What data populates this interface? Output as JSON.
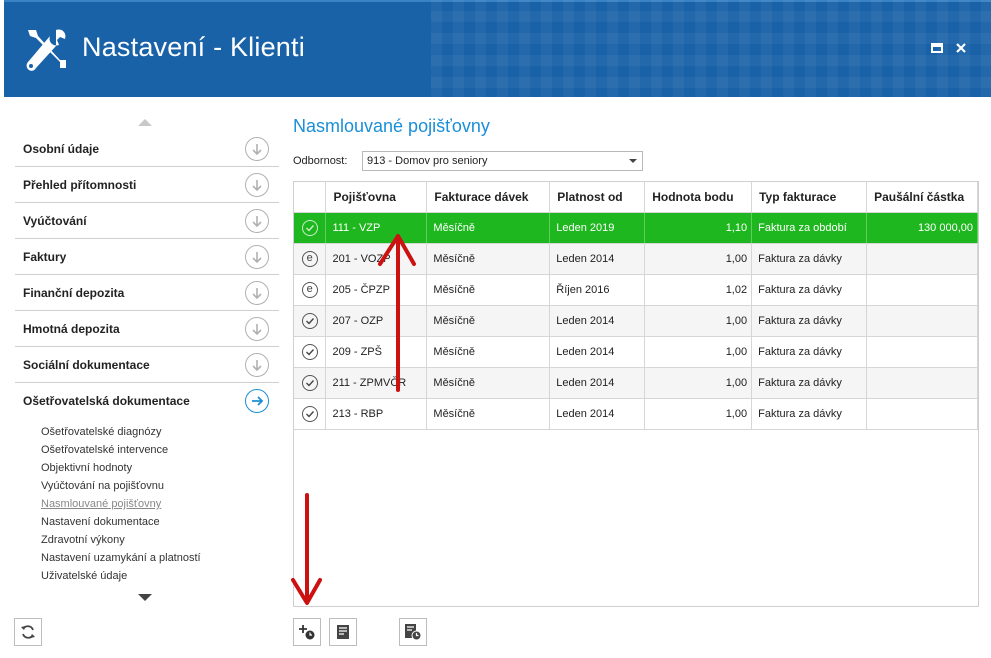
{
  "window": {
    "title": "Nastavení - Klienti"
  },
  "sidebar": {
    "sections": [
      {
        "label": "Osobní údaje"
      },
      {
        "label": "Přehled přítomnosti"
      },
      {
        "label": "Vyúčtování"
      },
      {
        "label": "Faktury"
      },
      {
        "label": "Finanční depozita"
      },
      {
        "label": "Hmotná depozita"
      },
      {
        "label": "Sociální dokumentace"
      },
      {
        "label": "Ošetřovatelská dokumentace"
      }
    ],
    "subitems": [
      {
        "label": "Ošetřovatelské diagnózy"
      },
      {
        "label": "Ošetřovatelské intervence"
      },
      {
        "label": "Objektivní hodnoty"
      },
      {
        "label": "Vyúčtování na pojišťovnu"
      },
      {
        "label": "Nasmlouvané pojišťovny"
      },
      {
        "label": "Nastavení dokumentace"
      },
      {
        "label": "Zdravotní výkony"
      },
      {
        "label": "Nastavení uzamykání a platností"
      },
      {
        "label": "Uživatelské údaje"
      }
    ]
  },
  "main": {
    "title": "Nasmlouvané pojišťovny",
    "odbornost_label": "Odbornost:",
    "odbornost_value": "913 - Domov pro seniory",
    "columns": [
      "Pojišťovna",
      "Fakturace dávek",
      "Platnost od",
      "Hodnota bodu",
      "Typ fakturace",
      "Paušální částka"
    ],
    "rows": [
      {
        "icon": "check",
        "pojistovna": "111 - VZP",
        "fakturace": "Měsíčně",
        "platnost": "Leden 2019",
        "hodnota": "1,10",
        "typ": "Faktura za období",
        "pausal": "130 000,00"
      },
      {
        "icon": "e",
        "pojistovna": "201 - VOZP",
        "fakturace": "Měsíčně",
        "platnost": "Leden 2014",
        "hodnota": "1,00",
        "typ": "Faktura za dávky",
        "pausal": ""
      },
      {
        "icon": "e",
        "pojistovna": "205 - ČPZP",
        "fakturace": "Měsíčně",
        "platnost": "Říjen 2016",
        "hodnota": "1,02",
        "typ": "Faktura za dávky",
        "pausal": ""
      },
      {
        "icon": "check",
        "pojistovna": "207 - OZP",
        "fakturace": "Měsíčně",
        "platnost": "Leden 2014",
        "hodnota": "1,00",
        "typ": "Faktura za dávky",
        "pausal": ""
      },
      {
        "icon": "check",
        "pojistovna": "209 - ZPŠ",
        "fakturace": "Měsíčně",
        "platnost": "Leden 2014",
        "hodnota": "1,00",
        "typ": "Faktura za dávky",
        "pausal": ""
      },
      {
        "icon": "check",
        "pojistovna": "211 - ZPMVČR",
        "fakturace": "Měsíčně",
        "platnost": "Leden 2014",
        "hodnota": "1,00",
        "typ": "Faktura za dávky",
        "pausal": ""
      },
      {
        "icon": "check",
        "pojistovna": "213 - RBP",
        "fakturace": "Měsíčně",
        "platnost": "Leden 2014",
        "hodnota": "1,00",
        "typ": "Faktura za dávky",
        "pausal": ""
      }
    ]
  },
  "colors": {
    "header": "#1a62a8",
    "accent": "#1a8fd8",
    "selected_row": "#1fb71f",
    "annotation_arrow": "#cc1111"
  }
}
